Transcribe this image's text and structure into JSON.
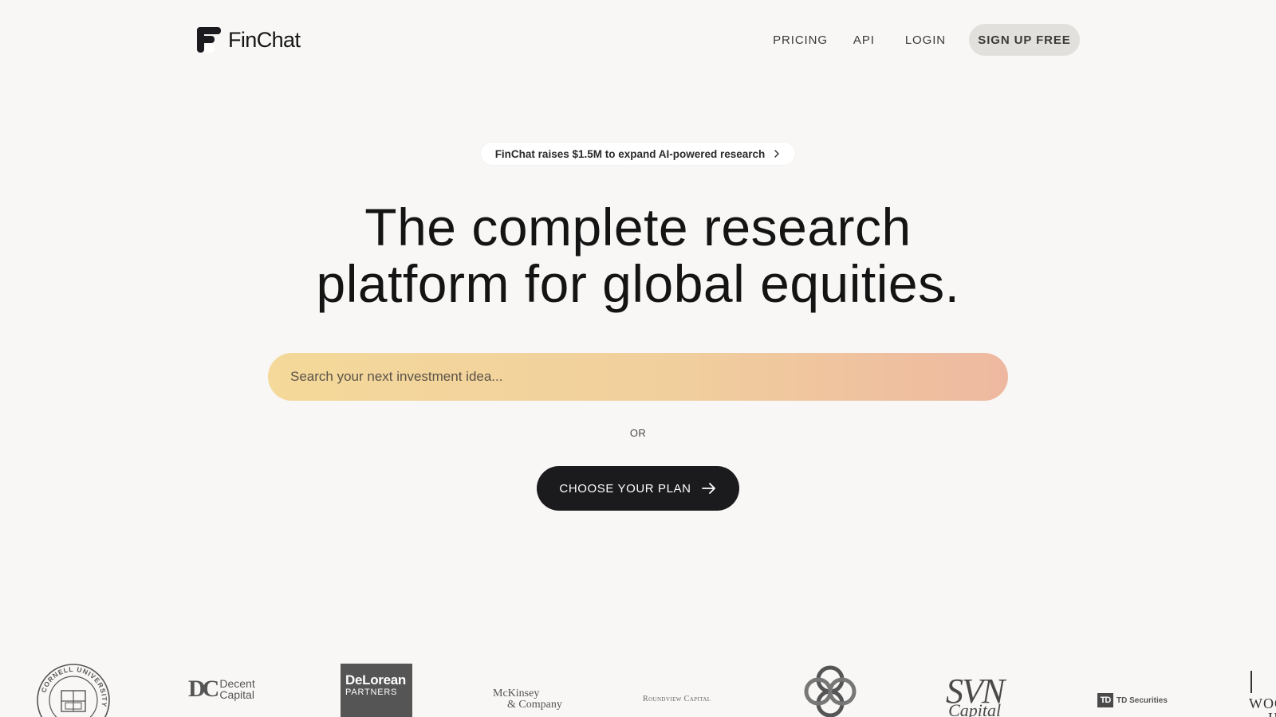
{
  "header": {
    "brand_name": "FinChat",
    "nav": {
      "pricing": "PRICING",
      "api": "API",
      "login": "LOGIN",
      "signup": "SIGN UP FREE"
    }
  },
  "announcement": {
    "text": "FinChat raises $1.5M to expand AI-powered research",
    "icon": "chevron-right-icon"
  },
  "hero": {
    "headline_line1": "The complete research",
    "headline_line2": "platform for global equities."
  },
  "search": {
    "placeholder": "Search your next investment idea...",
    "value": "",
    "gradient_from": "#f4d99a",
    "gradient_to": "#eeb8a0"
  },
  "divider_text": "OR",
  "cta": {
    "label": "CHOOSE YOUR PLAN",
    "icon": "arrow-right-icon"
  },
  "logos": {
    "cornell_ring_text": "CORNELL UNIVERSITY",
    "decent_mark": "DC",
    "decent_line1": "Decent",
    "decent_line2": "Capital",
    "delorean_line1": "DeLorean",
    "delorean_line2": "PARTNERS",
    "mckinsey_line1": "McKinsey",
    "mckinsey_line2": "& Company",
    "roundview": "Roundview Capital",
    "svn_mark": "SVN",
    "svn_sub": "Capital",
    "td_mark": "TD",
    "td_text": "TD Securities",
    "wood_line1": "WOO",
    "wood_line2": "H"
  },
  "colors": {
    "background": "#f8f7f5",
    "cta_bg": "#1b1b1e",
    "signup_bg": "#e2e0dc"
  }
}
